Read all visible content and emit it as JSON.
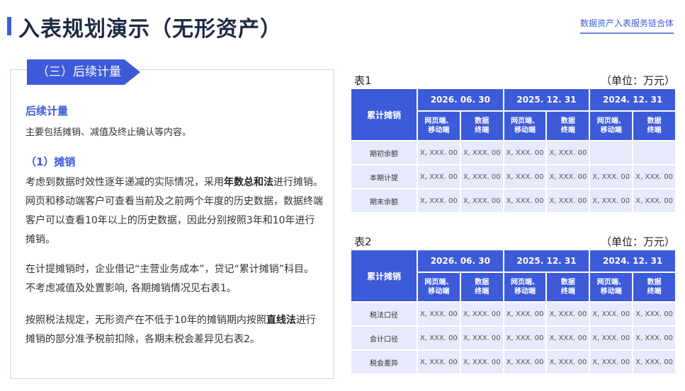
{
  "header": {
    "title": "入表规划演示（无形资产）",
    "link": "数据资产入表服务链合体"
  },
  "left": {
    "tab": "（三）后续计量",
    "sub1": "后续计量",
    "sub1_desc": "主要包括摊销、减值及终止确认等内容。",
    "sub2": "（1）摊销",
    "p1_a": "考虑到数据时效性逐年递减的实际情况，采用",
    "p1_b": "年数总和法",
    "p1_c": "进行摊销。网页和移动端客户可查看当前及之前两个年度的历史数据，数据终端客户可以查看10年以上的历史数据，因此分别按照3年和10年进行摊销。",
    "p2": "在计提摊销时，企业借记“主营业务成本”，贷记“累计摊销”科目。不考虑减值及处置影响, 各期摊销情况见右表1。",
    "p3_a": "按照税法规定，无形资产在不低于10年的摊销期内按照",
    "p3_b": "直线法",
    "p3_c": "进行摊销的部分准予税前扣除，各期末税会差异见右表2。"
  },
  "table1": {
    "title": "表1",
    "unit": "（单位：万元）",
    "row_head": "累计摊销",
    "dates": [
      "2026. 06. 30",
      "2025. 12. 31",
      "2024. 12. 31"
    ],
    "subheads": [
      [
        "网页端、",
        "移动端"
      ],
      [
        "数据",
        "终端"
      ],
      [
        "网页端、",
        "移动端"
      ],
      [
        "数据",
        "终端"
      ],
      [
        "网页端、",
        "移动端"
      ],
      [
        "数据",
        "终端"
      ]
    ],
    "rows": [
      {
        "label": "期初余额",
        "cells": [
          "X, XXX. 00",
          "X, XXX. 00",
          "X, XXX. 00",
          "X, XXX. 00",
          "",
          ""
        ]
      },
      {
        "label": "本期计提",
        "cells": [
          "X, XXX. 00",
          "X, XXX. 00",
          "X, XXX. 00",
          "X, XXX. 00",
          "X, XXX. 00",
          "X, XXX. 00"
        ]
      },
      {
        "label": "期末余额",
        "cells": [
          "X, XXX. 00",
          "X, XXX. 00",
          "X, XXX. 00",
          "X, XXX. 00",
          "X, XXX. 00",
          "X, XXX. 00"
        ]
      }
    ]
  },
  "table2": {
    "title": "表2",
    "unit": "（单位：万元）",
    "row_head": "累计摊销",
    "dates": [
      "2026. 06. 30",
      "2025. 12. 31",
      "2024. 12. 31"
    ],
    "subheads": [
      [
        "网页端、",
        "移动端"
      ],
      [
        "数据",
        "终端"
      ],
      [
        "网页端、",
        "移动端"
      ],
      [
        "数据",
        "终端"
      ],
      [
        "网页端、",
        "移动端"
      ],
      [
        "数据",
        "终端"
      ]
    ],
    "rows": [
      {
        "label": "税法口径",
        "cells": [
          "X, XXX. 00",
          "X, XXX. 00",
          "X, XXX. 00",
          "X, XXX. 00",
          "X, XXX. 00",
          "X, XXX. 00"
        ]
      },
      {
        "label": "会计口径",
        "cells": [
          "X, XXX. 00",
          "X, XXX. 00",
          "X, XXX. 00",
          "X, XXX. 00",
          "X, XXX. 00",
          "X, XXX. 00"
        ]
      },
      {
        "label": "税会差异",
        "cells": [
          "X, XXX. 00",
          "X, XXX. 00",
          "X, XXX. 00",
          "X, XXX. 00",
          "X, XXX. 00",
          "X, XXX. 00"
        ]
      }
    ]
  }
}
